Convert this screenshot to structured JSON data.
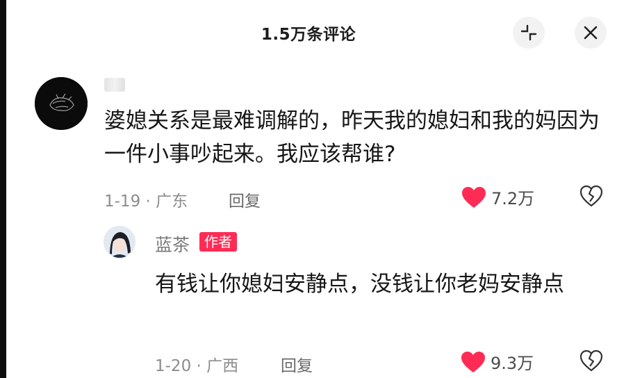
{
  "header": {
    "title": "1.5万条评论"
  },
  "comment": {
    "text": "婆媳关系是最难调解的，昨天我的媳妇和我的妈因为一件小事吵起来。我应该帮谁?",
    "date_location": "1-19 · 广东",
    "reply_label": "回复",
    "likes": "7.2万"
  },
  "reply": {
    "username": "蓝茶",
    "badge": "作者",
    "text": "有钱让你媳妇安静点，没钱让你老妈安静点",
    "date_location": "1-20 · 广西",
    "reply_label": "回复",
    "likes": "9.3万"
  },
  "colors": {
    "like_heart": "#fe2c55",
    "badge_bg": "#fe2c55",
    "meta_text": "#8c8c8c"
  },
  "icons": [
    "collapse-icon",
    "close-icon",
    "heart-icon",
    "dislike-icon"
  ]
}
